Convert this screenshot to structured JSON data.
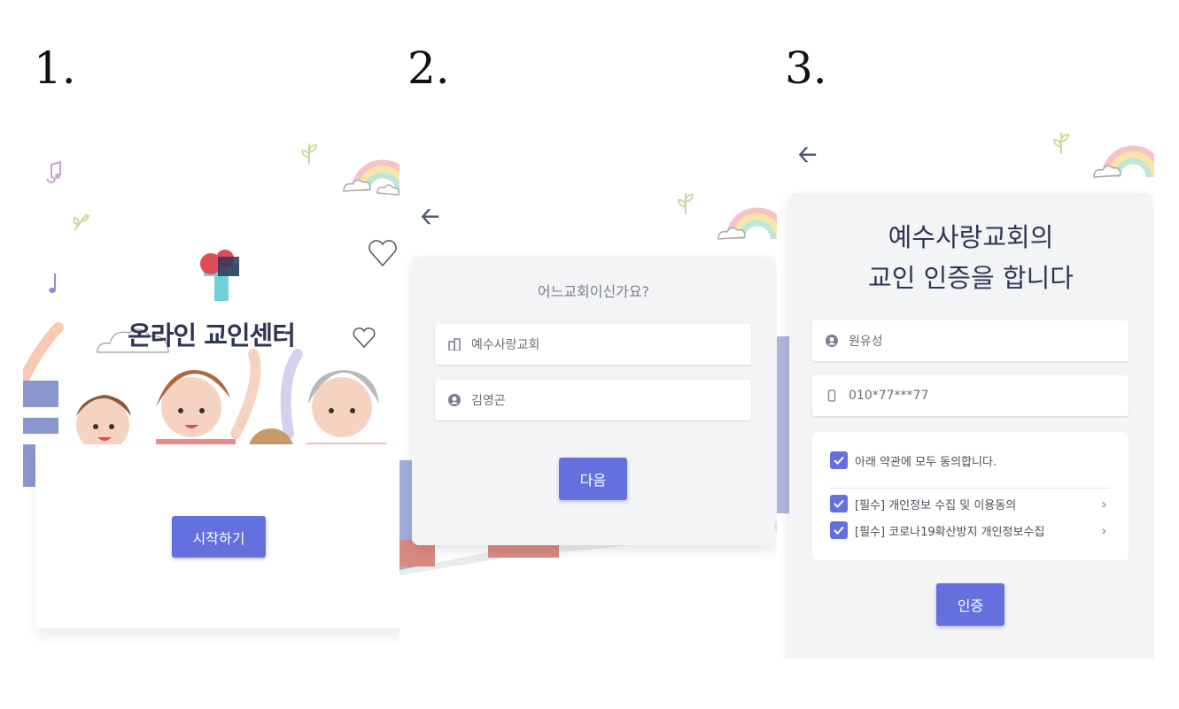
{
  "steps": {
    "one": "1.",
    "two": "2.",
    "three": "3."
  },
  "screen1": {
    "app_title": "온라인 교인센터",
    "start_button": "시작하기"
  },
  "screen2": {
    "question": "어느교회이신가요?",
    "church_field_value": "예수사랑교회",
    "name_field_value": "김영곤",
    "next_button": "다음"
  },
  "screen3": {
    "headline_line1": "예수사랑교회의",
    "headline_line2": "교인 인증을 합니다",
    "name_field_value": "원유성",
    "phone_field_value": "010*77***77",
    "agree_all": "아래 약관에 모두 동의합니다.",
    "term1": "[필수] 개인정보 수집 및 이용동의",
    "term2": "[필수] 코로나19확산방지 개인정보수집",
    "verify_button": "인증"
  },
  "colors": {
    "accent": "#6370de",
    "title": "#2f3654",
    "card_bg": "#f3f4f6"
  },
  "icons": [
    "back-arrow-icon",
    "building-icon",
    "user-circle-icon",
    "phone-icon",
    "checkbox-checked-icon",
    "chevron-right-icon",
    "rainbow-icon",
    "cloud-icon",
    "leaf-icon",
    "music-note-icon",
    "heart-outline-icon",
    "cross-logo-icon"
  ]
}
